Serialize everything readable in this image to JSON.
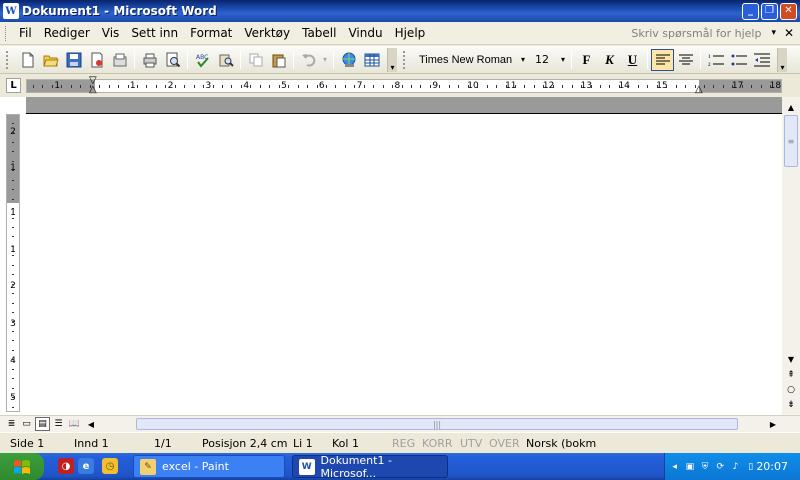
{
  "window": {
    "title": "Dokument1 - Microsoft Word",
    "app_icon": "W",
    "minimize": "_",
    "maximize": "❐",
    "close": "✕"
  },
  "menu": {
    "items": [
      "Fil",
      "Rediger",
      "Vis",
      "Sett inn",
      "Format",
      "Verktøy",
      "Tabell",
      "Vindu",
      "Hjelp"
    ],
    "help_placeholder": "Skriv spørsmål for hjelp",
    "help_arrow": "▾",
    "close_doc": "✕"
  },
  "toolbar": {
    "font_name": "Times New Roman",
    "font_size": "12",
    "dropdown_arrow": "▾",
    "bold_label": "F",
    "italic_label": "K",
    "underline_label": "U",
    "chevron": "»"
  },
  "ruler": {
    "tab_selector": "L",
    "numbers": [
      "1",
      "1",
      "2",
      "3",
      "4",
      "5",
      "6",
      "7",
      "8",
      "9",
      "10",
      "11",
      "12",
      "13",
      "14",
      "15",
      "",
      "17",
      "18"
    ],
    "vertical_numbers": [
      "2",
      "1",
      "1",
      "1",
      "2",
      "3",
      "4",
      "5"
    ]
  },
  "status": {
    "page": "Side  1",
    "section": "Innd  1",
    "pages": "1/1",
    "position": "Posisjon  2,4 cm",
    "line": "Li  1",
    "column": "Kol  1",
    "rec": "REG",
    "track": "KORR",
    "ext": "UTV",
    "ovr": "OVER",
    "language": "Norsk (bokm"
  },
  "taskbar": {
    "paint_label": "excel - Paint",
    "word_label": "Dokument1 - Microsof...",
    "clock": "20:07",
    "tray_arrow": "◂"
  },
  "colors": {
    "title_blue": "#1c4fb4",
    "taskbar_blue": "#245edb",
    "start_green": "#3c9e3c"
  },
  "icons": {
    "new": "new-document-icon",
    "open": "open-folder-icon",
    "save": "save-icon",
    "print": "print-icon",
    "spell": "spellcheck-icon"
  }
}
